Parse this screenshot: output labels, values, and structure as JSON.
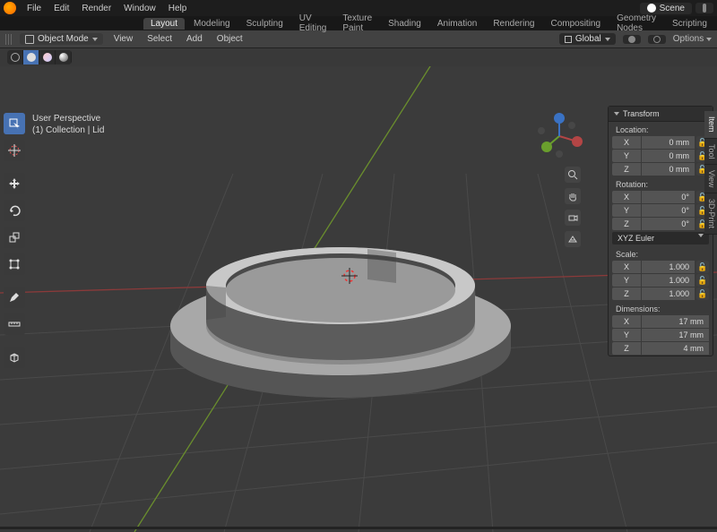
{
  "menubar": {
    "items": [
      "File",
      "Edit",
      "Render",
      "Window",
      "Help"
    ]
  },
  "scene_label": "Scene",
  "workspaces": {
    "items": [
      "Layout",
      "Modeling",
      "Sculpting",
      "UV Editing",
      "Texture Paint",
      "Shading",
      "Animation",
      "Rendering",
      "Compositing",
      "Geometry Nodes",
      "Scripting"
    ],
    "active": "Layout"
  },
  "header": {
    "mode": "Object Mode",
    "menus": [
      "View",
      "Select",
      "Add",
      "Object"
    ],
    "orientation": "Global",
    "options": "Options"
  },
  "overlay": {
    "line1": "User Perspective",
    "line2": "(1) Collection | Lid"
  },
  "transform": {
    "title": "Transform",
    "location": {
      "label": "Location:",
      "X": "0 mm",
      "Y": "0 mm",
      "Z": "0 mm"
    },
    "rotation": {
      "label": "Rotation:",
      "X": "0°",
      "Y": "0°",
      "Z": "0°",
      "order": "XYZ Euler"
    },
    "scale": {
      "label": "Scale:",
      "X": "1.000",
      "Y": "1.000",
      "Z": "1.000"
    },
    "dimensions": {
      "label": "Dimensions:",
      "X": "17 mm",
      "Y": "17 mm",
      "Z": "4 mm"
    }
  },
  "axes": {
    "X": "X",
    "Y": "Y",
    "Z": "Z"
  },
  "side_tabs": [
    "Item",
    "Tool",
    "View",
    "3D-Print"
  ],
  "colors": {
    "accent": "#4772b3",
    "x_axis": "#b34545",
    "y_axis": "#6a9e2d",
    "z_axis": "#3a72c4"
  }
}
